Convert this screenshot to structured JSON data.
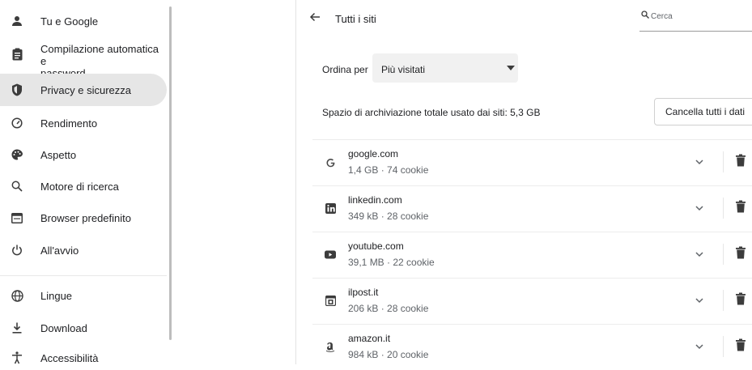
{
  "sidebar": {
    "items": [
      {
        "label": "Tu e Google",
        "icon": "person-icon"
      },
      {
        "label": "Compilazione automatica e",
        "label2": "password",
        "icon": "clipboard-icon"
      },
      {
        "label": "Privacy e sicurezza",
        "icon": "shield-icon",
        "active": true
      },
      {
        "label": "Rendimento",
        "icon": "speedometer-icon"
      },
      {
        "label": "Aspetto",
        "icon": "palette-icon"
      },
      {
        "label": "Motore di ricerca",
        "icon": "search-icon"
      },
      {
        "label": "Browser predefinito",
        "icon": "browser-window-icon"
      },
      {
        "label": "All'avvio",
        "icon": "power-icon"
      },
      {
        "label": "Lingue",
        "icon": "globe-icon"
      },
      {
        "label": "Download",
        "icon": "download-icon"
      },
      {
        "label": "Accessibilità",
        "icon": "accessibility-icon"
      }
    ]
  },
  "header": {
    "title": "Tutti i siti",
    "search_placeholder": "Cerca"
  },
  "sort": {
    "label": "Ordina per",
    "selected": "Più visitati"
  },
  "storage": {
    "text": "Spazio di archiviazione totale usato dai siti: 5,3 GB",
    "clear_label": "Cancella tutti i dati"
  },
  "sites": [
    {
      "name": "google.com",
      "meta": "1,4 GB · 74 cookie",
      "icon": "google-icon"
    },
    {
      "name": "linkedin.com",
      "meta": "349 kB · 28 cookie",
      "icon": "linkedin-icon"
    },
    {
      "name": "youtube.com",
      "meta": "39,1 MB · 22 cookie",
      "icon": "youtube-icon"
    },
    {
      "name": "ilpost.it",
      "meta": "206 kB · 28 cookie",
      "icon": "ilpost-icon"
    },
    {
      "name": "amazon.it",
      "meta": "984 kB · 20 cookie",
      "icon": "amazon-icon"
    }
  ]
}
